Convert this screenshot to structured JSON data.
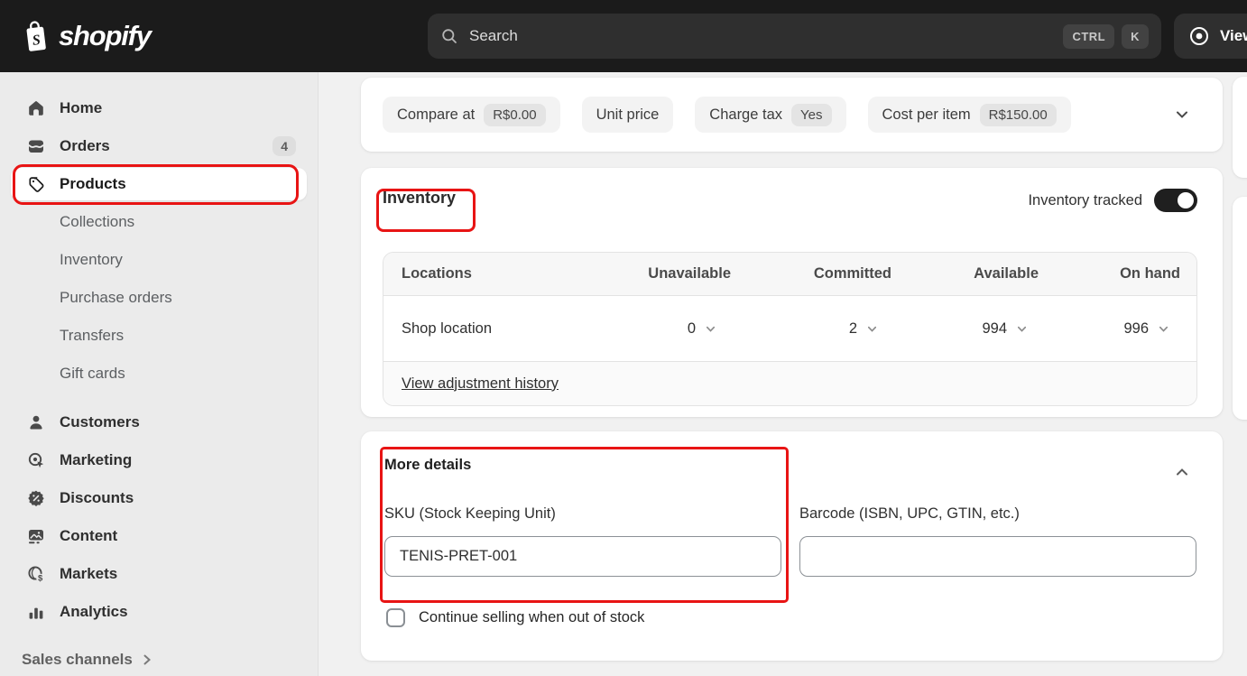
{
  "header": {
    "brand": "shopify",
    "search": {
      "placeholder": "Search",
      "shortcuts": [
        "CTRL",
        "K"
      ]
    },
    "view_button_label": "View"
  },
  "sidebar": {
    "items": [
      {
        "label": "Home"
      },
      {
        "label": "Orders",
        "badge": "4"
      },
      {
        "label": "Products",
        "active": true
      },
      {
        "label": "Collections",
        "sub": true
      },
      {
        "label": "Inventory",
        "sub": true
      },
      {
        "label": "Purchase orders",
        "sub": true
      },
      {
        "label": "Transfers",
        "sub": true
      },
      {
        "label": "Gift cards",
        "sub": true
      },
      {
        "label": "Customers"
      },
      {
        "label": "Marketing"
      },
      {
        "label": "Discounts"
      },
      {
        "label": "Content"
      },
      {
        "label": "Markets"
      },
      {
        "label": "Analytics"
      }
    ],
    "footer_label": "Sales channels"
  },
  "pricing": {
    "pills": [
      {
        "label": "Compare at",
        "value": "R$0.00"
      },
      {
        "label": "Unit price",
        "value": ""
      },
      {
        "label": "Charge tax",
        "value": "Yes"
      },
      {
        "label": "Cost per item",
        "value": "R$150.00"
      }
    ]
  },
  "inventory": {
    "title": "Inventory",
    "tracked_label": "Inventory tracked",
    "tracked_on": true,
    "table": {
      "columns": [
        "Locations",
        "Unavailable",
        "Committed",
        "Available",
        "On hand"
      ],
      "rows": [
        {
          "location": "Shop location",
          "unavailable": "0",
          "committed": "2",
          "available": "994",
          "on_hand": "996"
        }
      ],
      "footer_link": "View adjustment history"
    }
  },
  "more_details": {
    "title": "More details",
    "sku_label": "SKU (Stock Keeping Unit)",
    "sku_value": "TENIS-PRET-001",
    "barcode_label": "Barcode (ISBN, UPC, GTIN, etc.)",
    "barcode_value": "",
    "continue_selling_label": "Continue selling when out of stock",
    "continue_selling_checked": false
  },
  "colors": {
    "annotation_red": "#e81414",
    "header_bg": "#1b1b1b",
    "sidebar_bg": "#ebebeb",
    "content_bg": "#f1f1f1",
    "toggle_on": "#1f1f1f"
  }
}
